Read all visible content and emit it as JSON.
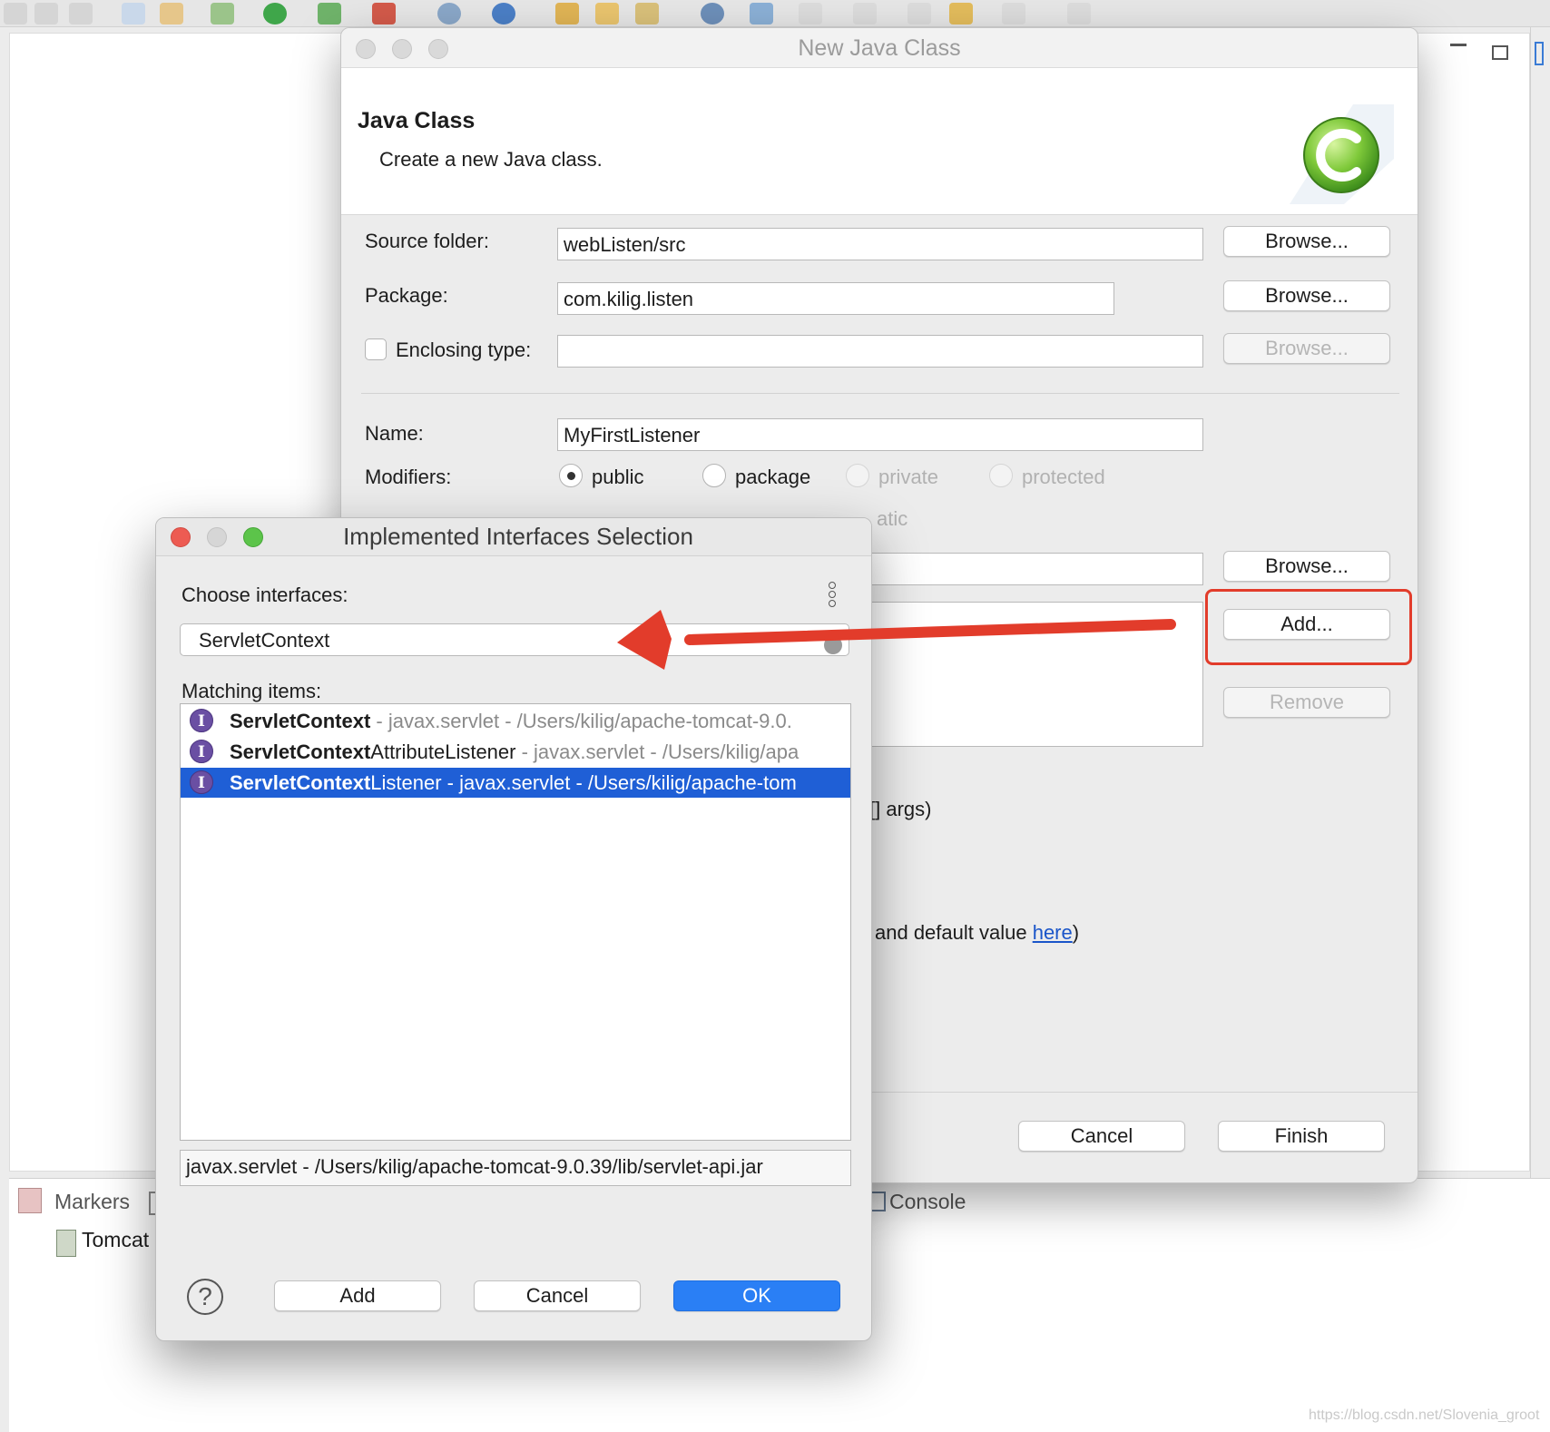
{
  "ide": {
    "bottom_tabs": {
      "markers": "Markers",
      "console": "Console"
    },
    "server_item": "Tomcat",
    "watermark": "https://blog.csdn.net/Slovenia_groot"
  },
  "java_dialog": {
    "window_title": "New Java Class",
    "heading": "Java Class",
    "description": "Create a new Java class.",
    "source_folder_label": "Source folder:",
    "source_folder_value": "webListen/src",
    "package_label": "Package:",
    "package_value": "com.kilig.listen",
    "enclosing_label": "Enclosing type:",
    "enclosing_value": "",
    "name_label": "Name:",
    "name_value": "MyFirstListener",
    "modifiers_label": "Modifiers:",
    "modifiers": [
      "public",
      "package",
      "private",
      "protected"
    ],
    "modifier_selected": "public",
    "modifier_row2_partial": "atic",
    "browse_label": "Browse...",
    "add_label": "Add...",
    "remove_label": "Remove",
    "method_stub_partial": "[] args)",
    "comments_partial_prefix": "and default value ",
    "comments_link": "here",
    "comments_partial_suffix": ")",
    "cancel_label": "Cancel",
    "finish_label": "Finish"
  },
  "ii_dialog": {
    "window_title": "Implemented Interfaces Selection",
    "choose_label": "Choose interfaces:",
    "search_value": "ServletContext",
    "matching_label": "Matching items:",
    "items": [
      {
        "bold": "ServletContext",
        "rest": "",
        "detail": " - javax.servlet - /Users/kilig/apache-tomcat-9.0.",
        "selected": false
      },
      {
        "bold": "ServletContext",
        "rest": "AttributeListener",
        "detail": " - javax.servlet - /Users/kilig/apa",
        "selected": false
      },
      {
        "bold": "ServletContext",
        "rest": "Listener",
        "detail": " - javax.servlet - /Users/kilig/apache-tom",
        "selected": true
      }
    ],
    "icon_letter": "I",
    "location": "javax.servlet - /Users/kilig/apache-tomcat-9.0.39/lib/servlet-api.jar",
    "help_symbol": "?",
    "add_label": "Add",
    "cancel_label": "Cancel",
    "ok_label": "OK"
  },
  "colors": {
    "accent": "#1f5fd6",
    "annotation_red": "#e23c2b",
    "ok_button": "#2a7ff5"
  }
}
